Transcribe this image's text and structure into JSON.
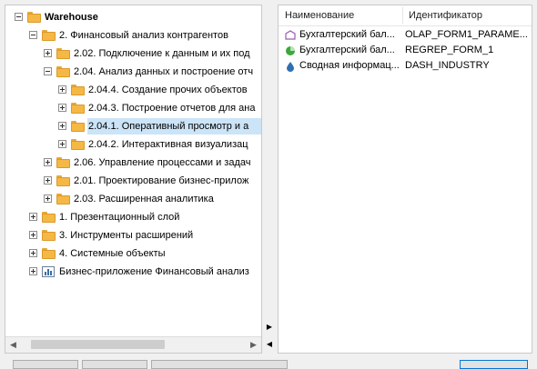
{
  "tree": {
    "items": [
      {
        "label": "Warehouse",
        "level": 0,
        "expander": "minus",
        "icon": "folder-icon",
        "bold": true
      },
      {
        "label": "2. Финансовый анализ контрагентов",
        "level": 1,
        "expander": "minus",
        "icon": "folder-icon"
      },
      {
        "label": "2.02. Подключение к данным и их под",
        "level": 2,
        "expander": "plus",
        "icon": "folder-icon"
      },
      {
        "label": "2.04. Анализ данных и построение отч",
        "level": 2,
        "expander": "minus",
        "icon": "folder-icon"
      },
      {
        "label": "2.04.4. Создание прочих объектов",
        "level": 3,
        "expander": "plus",
        "icon": "folder-icon"
      },
      {
        "label": "2.04.3. Построение отчетов для ана",
        "level": 3,
        "expander": "plus",
        "icon": "folder-icon"
      },
      {
        "label": "2.04.1. Оперативный просмотр и а",
        "level": 3,
        "expander": "plus",
        "icon": "folder-icon",
        "selected": true
      },
      {
        "label": "2.04.2. Интерактивная визуализац",
        "level": 3,
        "expander": "plus",
        "icon": "folder-icon"
      },
      {
        "label": "2.06. Управление процессами и задач",
        "level": 2,
        "expander": "plus",
        "icon": "folder-icon"
      },
      {
        "label": "2.01. Проектирование бизнес-прилож",
        "level": 2,
        "expander": "plus",
        "icon": "folder-icon"
      },
      {
        "label": "2.03. Расширенная аналитика",
        "level": 2,
        "expander": "plus",
        "icon": "folder-icon"
      },
      {
        "label": "1. Презентационный слой",
        "level": 1,
        "expander": "plus",
        "icon": "folder-icon"
      },
      {
        "label": "3. Инструменты расширений",
        "level": 1,
        "expander": "plus",
        "icon": "folder-icon"
      },
      {
        "label": "4. Системные объекты",
        "level": 1,
        "expander": "plus",
        "icon": "folder-icon"
      },
      {
        "label": "Бизнес-приложение Финансовый анализ",
        "level": 1,
        "expander": "plus",
        "icon": "business-app-icon"
      }
    ]
  },
  "list": {
    "columns": [
      "Наименование",
      "Идентификатор"
    ],
    "rows": [
      {
        "name": "Бухгалтерский бал...",
        "id": "OLAP_FORM1_PARAME...",
        "icon": "olap-report-icon"
      },
      {
        "name": "Бухгалтерский бал...",
        "id": "REGREP_FORM_1",
        "icon": "regular-report-icon"
      },
      {
        "name": "Сводная информац...",
        "id": "DASH_INDUSTRY",
        "icon": "dashboard-icon"
      }
    ]
  },
  "splitter": {
    "expand_right_glyph": "▶",
    "collapse_left_glyph": "◀"
  },
  "scrollbar": {
    "left_arrow": "◀",
    "right_arrow": "▶"
  },
  "colors": {
    "folder": "#f5b845",
    "selection": "#cce4f7",
    "olap_icon": "#9b59b6",
    "regular_report_icon": "#3ca83c",
    "dashboard_icon": "#2f6fb2"
  }
}
